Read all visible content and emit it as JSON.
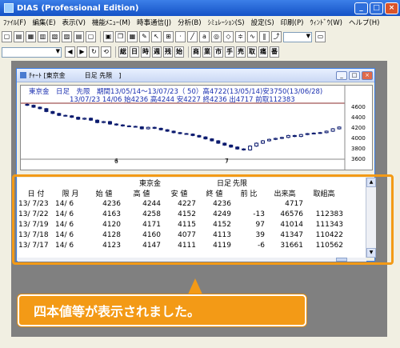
{
  "window": {
    "title": "DIAS (Professional Edition)",
    "minimize": "_",
    "maximize": "□",
    "close": "×"
  },
  "menu": [
    "ﾌｧｲﾙ(F)",
    "編集(E)",
    "表示(V)",
    "機能ﾒﾆｭｰ(M)",
    "時事通信(J)",
    "分析(B)",
    "ｼﾐｭﾚｰｼｮﾝ(S)",
    "設定(S)",
    "印刷(P)",
    "ｳｨﾝﾄﾞｳ(W)",
    "ヘルプ(H)"
  ],
  "toolbar2_buttons": [
    "総",
    "日",
    "時",
    "週",
    "残",
    "始",
    "商",
    "業",
    "市",
    "手",
    "売",
    "取",
    "痛",
    "番"
  ],
  "chart_window": {
    "title": "ﾁｬｰﾄ [東京金　　　日足 先限　]",
    "info_line1": "東京金　日足　先限　期間13/05/14～13/07/23（ 50）高4722(13/05/14)安3750(13/06/28)",
    "info_line2": "13/07/23 14/06 始4236 高4244 安4227 終4236 出4717 前取112383",
    "y_ticks": [
      "4600",
      "4400",
      "4200",
      "4000",
      "3800",
      "3600"
    ],
    "x_ticks": [
      "6",
      "7"
    ]
  },
  "chart_data": {
    "type": "candlestick",
    "y_range": [
      3600,
      4700
    ],
    "x_tick_labels": [
      "6",
      "7"
    ]
  },
  "quote_table": {
    "title_commodity": "東京金",
    "title_period": "日足",
    "title_contract": "先限",
    "headers": [
      "日 付",
      "限 月",
      "始 値",
      "高 値",
      "安 値",
      "終 値",
      "前 比",
      "出来高",
      "取組高"
    ],
    "rows": [
      [
        "13/ 7/23",
        "14/ 6",
        "4236",
        "4244",
        "4227",
        "4236",
        "",
        "4717",
        ""
      ],
      [
        "13/ 7/22",
        "14/ 6",
        "4163",
        "4258",
        "4152",
        "4249",
        "-13",
        "46576",
        "112383"
      ],
      [
        "13/ 7/19",
        "14/ 6",
        "4120",
        "4171",
        "4115",
        "4152",
        "97",
        "41014",
        "111343"
      ],
      [
        "13/ 7/18",
        "14/ 6",
        "4128",
        "4160",
        "4077",
        "4113",
        "39",
        "41347",
        "110422"
      ],
      [
        "13/ 7/17",
        "14/ 6",
        "4123",
        "4147",
        "4111",
        "4119",
        "-6",
        "31661",
        "110562"
      ]
    ]
  },
  "callout": {
    "text": "四本値等が表示されました。"
  },
  "colors": {
    "accent": "#f39a16",
    "info_text": "#1a2fb0",
    "candle": "#0b1a6e"
  }
}
